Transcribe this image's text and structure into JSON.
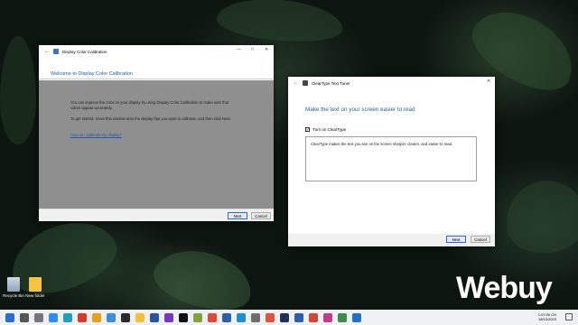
{
  "desktop": {
    "icons": [
      {
        "label": "Recycle Bin",
        "icon": "recycle-bin-icon"
      },
      {
        "label": "New folder",
        "icon": "folder-icon"
      }
    ],
    "watermark": "Webuy"
  },
  "calibration_window": {
    "title": "Display Color Calibration",
    "header": "Welcome to Display Color Calibration",
    "para1": "You can improve the color on your display by using Display Color Calibration to make sure that colors appear accurately.",
    "para2": "To get started, move this window onto the display that you want to calibrate, and then click Next.",
    "link": "How do I calibrate my display?",
    "next_label": "Next",
    "cancel_label": "Cancel"
  },
  "cleartype_window": {
    "title": "ClearType Text Tuner",
    "heading": "Make the text on your screen easier to read",
    "checkbox_label": "Turn on ClearType",
    "checkbox_checked": true,
    "description": "ClearType makes the text you see on the screen sharper, clearer, and easier to read.",
    "next_label": "Next",
    "cancel_label": "Cancel"
  },
  "taskbar": {
    "apps": [
      {
        "icon": "windows-start-icon",
        "color": "#2b6fd6"
      },
      {
        "icon": "search-icon",
        "color": "#555555"
      },
      {
        "icon": "task-view-icon",
        "color": "#777777"
      },
      {
        "icon": "zoom-icon",
        "color": "#2d8cff"
      },
      {
        "icon": "edge-icon",
        "color": "#1ea1c1"
      },
      {
        "icon": "record-icon",
        "color": "#d83b2c"
      },
      {
        "icon": "chrome-icon",
        "color": "#e3a21a"
      },
      {
        "icon": "photos-icon",
        "color": "#3a8ede"
      },
      {
        "icon": "sticky-notes-icon",
        "color": "#2b2b2b"
      },
      {
        "icon": "file-explorer-icon",
        "color": "#f2c23a"
      },
      {
        "icon": "word-icon",
        "color": "#2b579a"
      },
      {
        "icon": "onenote-icon",
        "color": "#7a36c0"
      },
      {
        "icon": "terminal-icon",
        "color": "#111111"
      },
      {
        "icon": "vlc-icon",
        "color": "#7fa336"
      },
      {
        "icon": "chrome-icon",
        "color": "#de4a3a"
      },
      {
        "icon": "app-icon",
        "color": "#2d5fab"
      },
      {
        "icon": "edge-icon",
        "color": "#1c8fd8"
      },
      {
        "icon": "settings-icon",
        "color": "#6e6e6e"
      },
      {
        "icon": "chrome-icon",
        "color": "#e0523c"
      },
      {
        "icon": "photoshop-icon",
        "color": "#1f2f56"
      },
      {
        "icon": "word-icon",
        "color": "#2c5fb0"
      },
      {
        "icon": "chrome-icon",
        "color": "#d6452f"
      },
      {
        "icon": "paint-icon",
        "color": "#c23b8c"
      },
      {
        "icon": "app-icon",
        "color": "#3a8e4a"
      },
      {
        "icon": "app-icon",
        "color": "#1e74c8"
      }
    ],
    "time": "1:07:00 CH",
    "date": "18/10/2023"
  }
}
